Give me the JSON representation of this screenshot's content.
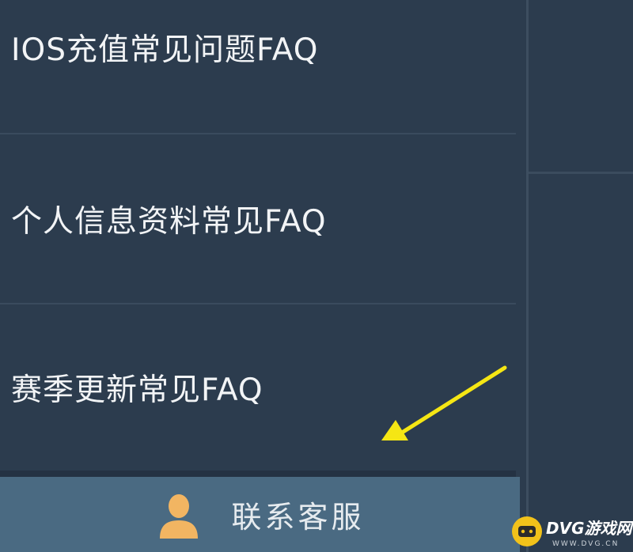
{
  "faq": {
    "items": [
      {
        "label": "IOS充值常见问题FAQ"
      },
      {
        "label": "个人信息资料常见FAQ"
      },
      {
        "label": "赛季更新常见FAQ"
      }
    ]
  },
  "contact": {
    "label": "联系客服",
    "icon": "user-icon"
  },
  "watermark": {
    "text": "DVG游戏网",
    "url_text": "WWW.DVG.CN"
  },
  "colors": {
    "background": "#2c3c4e",
    "button": "#4a6a82",
    "arrow": "#f5e614",
    "icon": "#f2b562"
  }
}
